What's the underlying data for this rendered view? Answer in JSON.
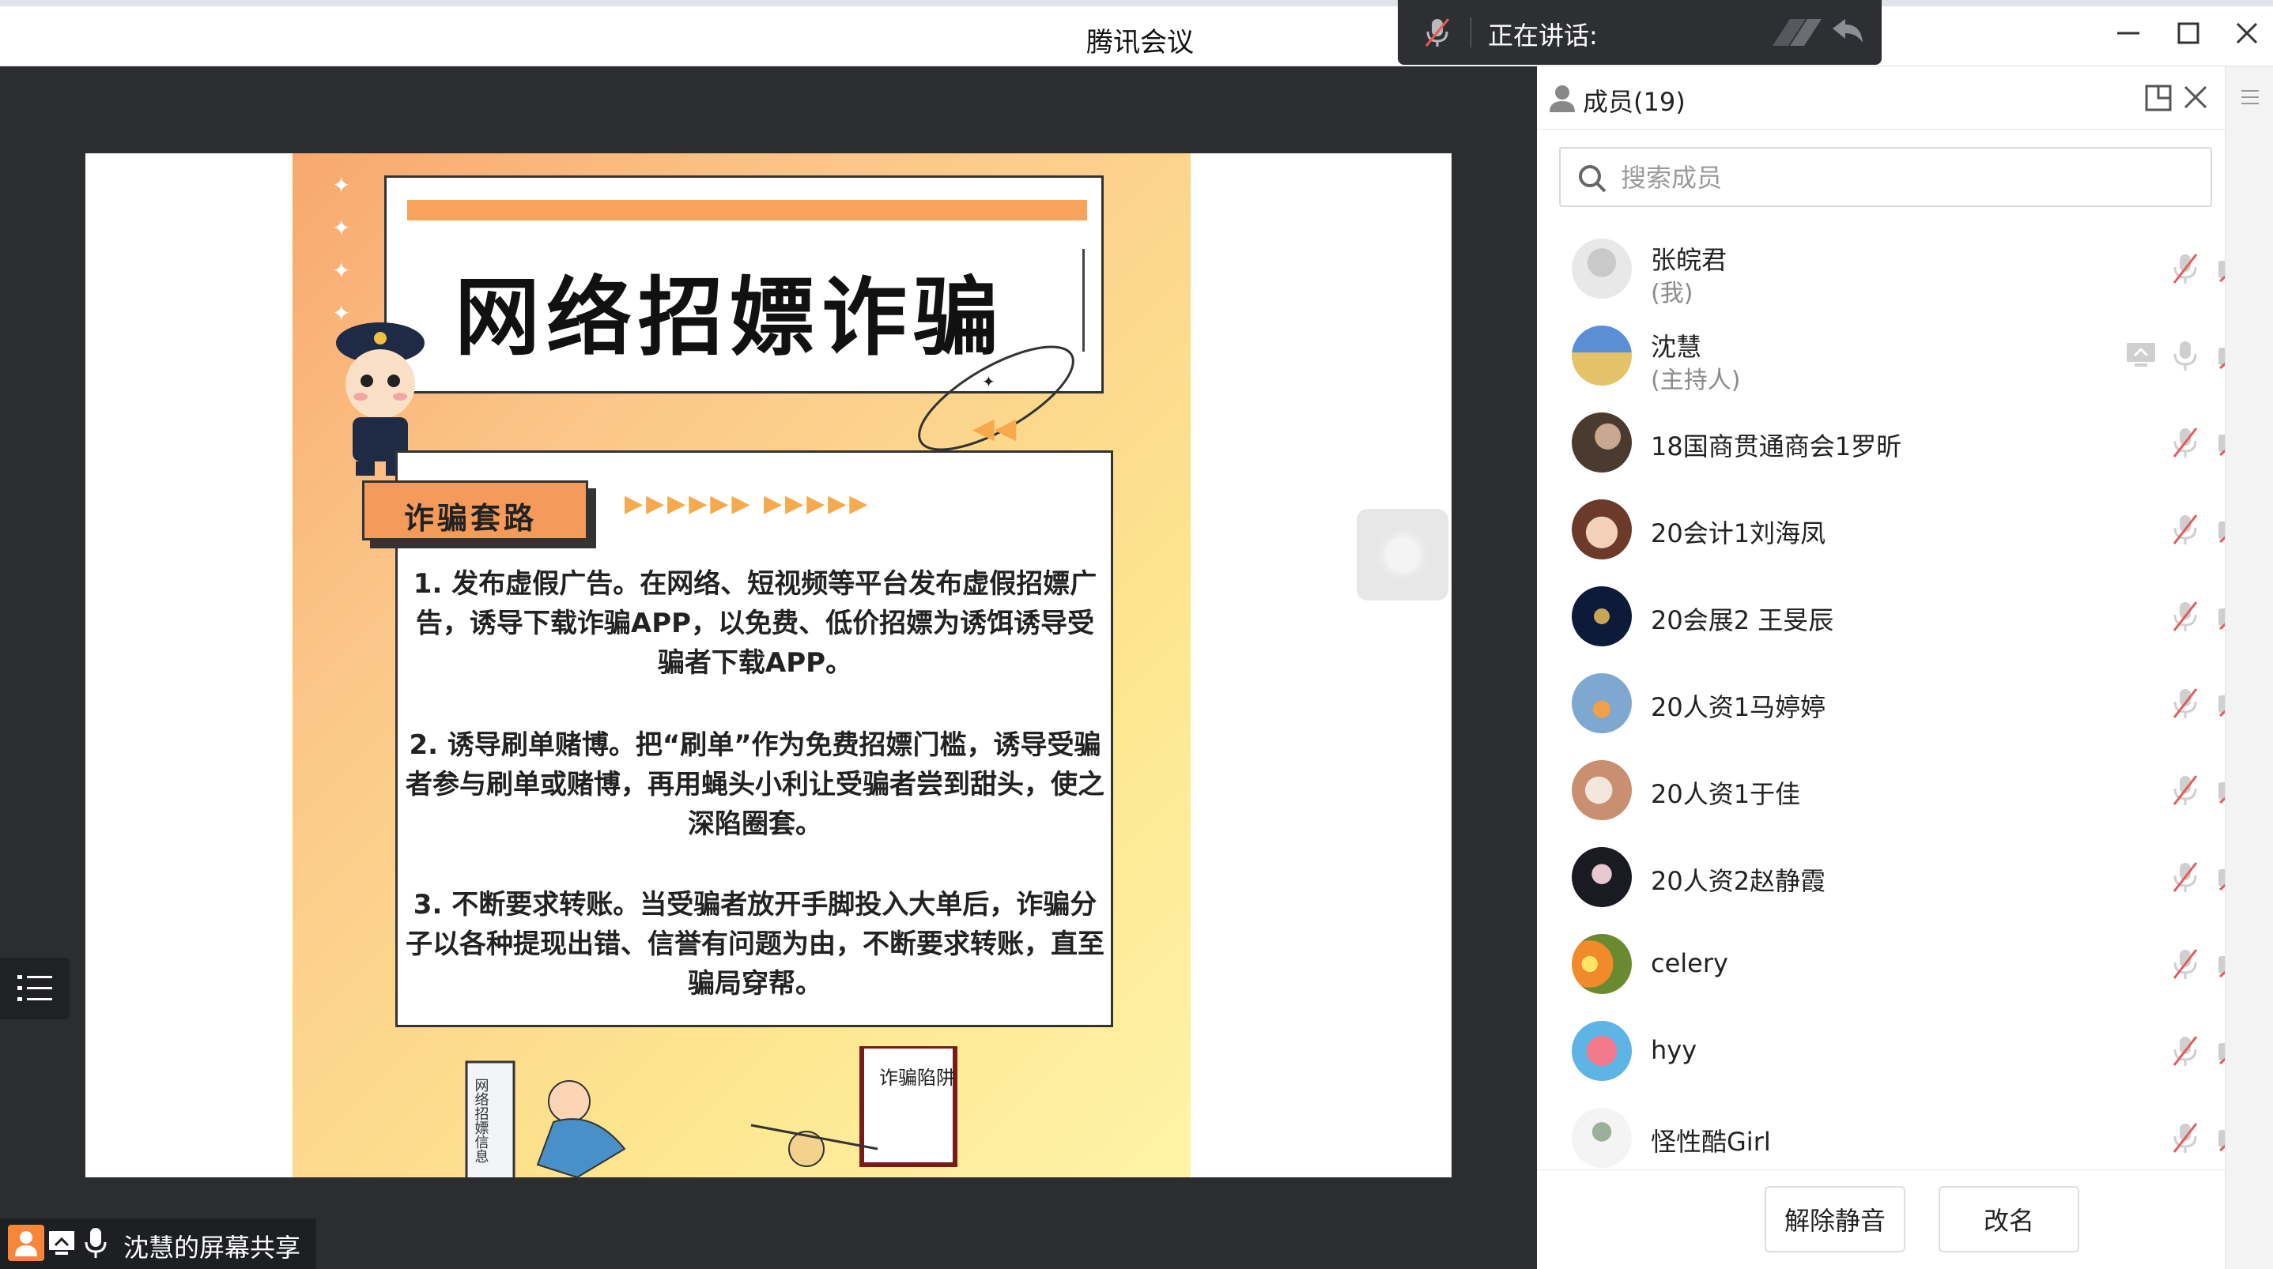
{
  "window": {
    "title": "腾讯会议",
    "speaking_label": "正在讲话:"
  },
  "share": {
    "label": "沈慧的屏幕共享"
  },
  "slide": {
    "title": "网络招嫖诈骗",
    "tag": "诈骗套路",
    "arrows": "▶▶▶▶▶▶ ▶▶▶▶▶",
    "p1": "1. 发布虚假广告。在网络、短视频等平台发布虚假招嫖广告，诱导下载诈骗APP，以免费、低价招嫖为诱饵诱导受骗者下载APP。",
    "p2": "2. 诱导刷单赌博。把“刷单”作为免费招嫖门槛，诱导受骗者参与刷单或赌博，再用蝇头小利让受骗者尝到甜头，使之深陷圈套。",
    "p3": "3. 不断要求转账。当受骗者放开手脚投入大单后，诈骗分子以各种提现出错、信誉有问题为由，不断要求转账，直至骗局穿帮。",
    "sign1": "网络招嫖信息",
    "sign2": "诈骗陷阱"
  },
  "panel": {
    "title": "成员(19)",
    "search_placeholder": "搜索成员",
    "members": [
      {
        "name": "张皖君",
        "role": "(我)",
        "avatar": "default"
      },
      {
        "name": "沈慧",
        "role": "(主持人)",
        "avatar": "landscape"
      },
      {
        "name": "18国商贯通商会1罗昕",
        "role": "",
        "avatar": "photo-brown"
      },
      {
        "name": "20会计1刘海凤",
        "role": "",
        "avatar": "photo-child"
      },
      {
        "name": "20会展2 王旻辰",
        "role": "",
        "avatar": "photo-dark-blue"
      },
      {
        "name": "20人资1马婷婷",
        "role": "",
        "avatar": "photo-blue-cup"
      },
      {
        "name": "20人资1于佳",
        "role": "",
        "avatar": "photo-pink"
      },
      {
        "name": "20人资2赵静霞",
        "role": "",
        "avatar": "photo-dark"
      },
      {
        "name": "celery",
        "role": "",
        "avatar": "sunset"
      },
      {
        "name": "hyy",
        "role": "",
        "avatar": "flamingo"
      },
      {
        "name": "怪性酷Girl",
        "role": "",
        "avatar": "sketch-girl"
      }
    ],
    "buttons": {
      "unmute": "解除静音",
      "rename": "改名"
    }
  },
  "colors": {
    "main_bg": "#2b2d31",
    "accent_orange": "#f7853a",
    "muted_red": "#e55a5a"
  }
}
